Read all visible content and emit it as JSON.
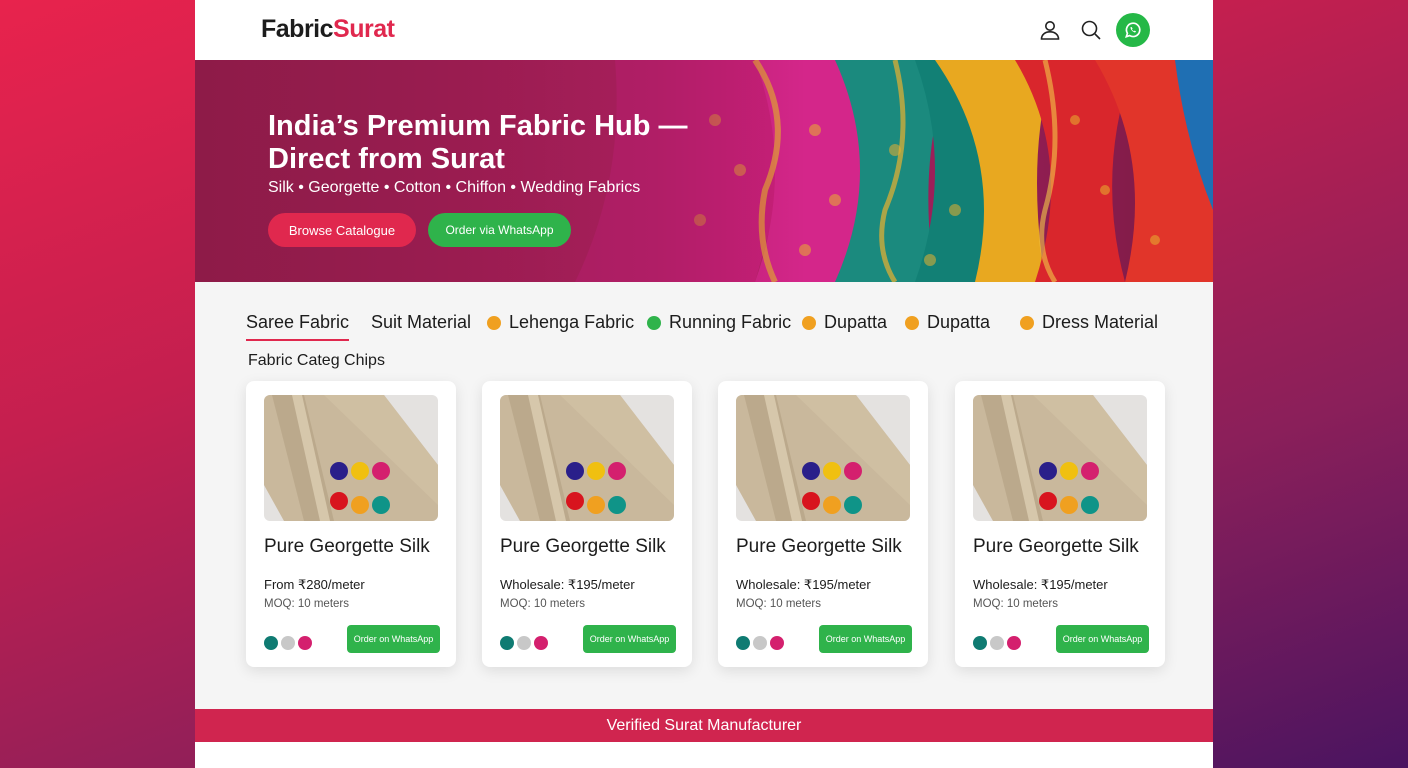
{
  "header": {
    "logo_part1": "Fabric",
    "logo_part2": "Surat"
  },
  "icons": {
    "user": "user-icon",
    "search": "search-icon",
    "whatsapp": "whatsapp-icon"
  },
  "hero": {
    "title": "India’s Premium Fabric Hub — Direct from Surat",
    "subtitle": "Silk • Georgette • Cotton • Chiffon • Wedding Fabrics",
    "browse_label": "Browse Catalogue",
    "whatsapp_label": "Order via WhatsApp"
  },
  "chips": [
    {
      "label": "Saree Fabric",
      "dot": "",
      "active": true
    },
    {
      "label": "Suit Material",
      "dot": ""
    },
    {
      "label": "Lehenga Fabric",
      "dot": "#f0a020"
    },
    {
      "label": "Running Fabric",
      "dot": "#2fb34b"
    },
    {
      "label": "Dupatta",
      "dot": "#f0a020"
    },
    {
      "label": "Dupatta",
      "dot": "#f0a020"
    },
    {
      "label": "Dress Material",
      "dot": "#f0a020"
    }
  ],
  "section_label": "Fabric Categ Chips",
  "products": [
    {
      "name": "Pure Georgette Silk",
      "price": "From ₹280/meter",
      "moq": "MOQ: 10 meters",
      "order_label": "Order on WhatsApp",
      "swatches": [
        "#0f7b72",
        "#c8c8c8",
        "#d4206e"
      ]
    },
    {
      "name": "Pure Georgette Silk",
      "price": "Wholesale: ₹195/meter",
      "moq": "MOQ: 10 meters",
      "order_label": "Order on WhatsApp",
      "swatches": [
        "#0f7b72",
        "#c8c8c8",
        "#d4206e"
      ]
    },
    {
      "name": "Pure Georgette Silk",
      "price": "Wholesale: ₹195/meter",
      "moq": "MOQ: 10 meters",
      "order_label": "Order on WhatsApp",
      "swatches": [
        "#0f7b72",
        "#c8c8c8",
        "#d4206e"
      ]
    },
    {
      "name": "Pure Georgette Silk",
      "price": "Wholesale: ₹195/meter",
      "moq": "MOQ: 10 meters",
      "order_label": "Order on WhatsApp",
      "swatches": [
        "#0f7b72",
        "#c8c8c8",
        "#d4206e"
      ]
    }
  ],
  "fabric_dots": [
    "#2a1f8a",
    "#f0c010",
    "#d4206e",
    "#d8141e",
    "#f0a020",
    "#0f9488"
  ],
  "footer": {
    "verified": "Verified Surat Manufacturer"
  },
  "colors": {
    "brand": "#e0284e",
    "whatsapp": "#2fb34b"
  }
}
